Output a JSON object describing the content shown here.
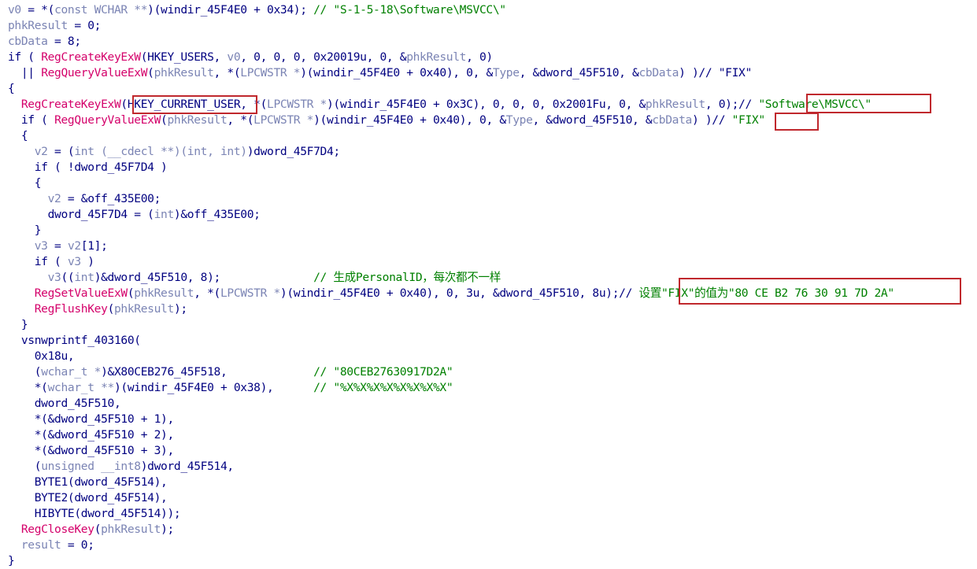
{
  "editor": {
    "lines": [
      [
        [
          "v",
          "v0"
        ],
        [
          "n",
          " = *("
        ],
        [
          "v",
          "const WCHAR **"
        ],
        [
          "n",
          ")(windir_45F4E0 + 0x34); "
        ],
        [
          "c",
          "// \"S-1-5-18\\Software\\MSVCC\\\""
        ]
      ],
      [
        [
          "v",
          "phkResult"
        ],
        [
          "n",
          " = 0;"
        ]
      ],
      [
        [
          "v",
          "cbData"
        ],
        [
          "n",
          " = 8;"
        ]
      ],
      [
        [
          "n",
          "if ( "
        ],
        [
          "f",
          "RegCreateKeyExW"
        ],
        [
          "n",
          "(HKEY_USERS, "
        ],
        [
          "v",
          "v0"
        ],
        [
          "n",
          ", 0, 0, 0, 0x20019u, 0, &"
        ],
        [
          "v",
          "phkResult"
        ],
        [
          "n",
          ", 0)"
        ]
      ],
      [
        [
          "n",
          "  || "
        ],
        [
          "f",
          "RegQueryValueExW"
        ],
        [
          "n",
          "("
        ],
        [
          "v",
          "phkResult"
        ],
        [
          "n",
          ", *("
        ],
        [
          "v",
          "LPCWSTR *"
        ],
        [
          "n",
          ")(windir_45F4E0 + 0x40), 0, &"
        ],
        [
          "v",
          "Type"
        ],
        [
          "n",
          ", &dword_45F510, &"
        ],
        [
          "v",
          "cbData"
        ],
        [
          "n",
          ") )// \"FIX\""
        ]
      ],
      [
        [
          "n",
          "{"
        ]
      ],
      [
        [
          "n",
          "  "
        ],
        [
          "f",
          "RegCreateKeyExW"
        ],
        [
          "n",
          "(HKEY_CURRENT_USER, *("
        ],
        [
          "v",
          "LPCWSTR *"
        ],
        [
          "n",
          ")(windir_45F4E0 + 0x3C), 0, 0, 0, 0x2001Fu, 0, &"
        ],
        [
          "v",
          "phkResult"
        ],
        [
          "n",
          ", 0);// "
        ],
        [
          "c",
          "\"Software\\MSVCC\\\""
        ]
      ],
      [
        [
          "n",
          "  if ( "
        ],
        [
          "f",
          "RegQueryValueExW"
        ],
        [
          "n",
          "("
        ],
        [
          "v",
          "phkResult"
        ],
        [
          "n",
          ", *("
        ],
        [
          "v",
          "LPCWSTR *"
        ],
        [
          "n",
          ")(windir_45F4E0 + 0x40), 0, &"
        ],
        [
          "v",
          "Type"
        ],
        [
          "n",
          ", &dword_45F510, &"
        ],
        [
          "v",
          "cbData"
        ],
        [
          "n",
          ") )// "
        ],
        [
          "c",
          "\"FIX\""
        ]
      ],
      [
        [
          "n",
          "  {"
        ]
      ],
      [
        [
          "n",
          "    "
        ],
        [
          "v",
          "v2"
        ],
        [
          "n",
          " = ("
        ],
        [
          "v",
          "int (__cdecl **)(int, int)"
        ],
        [
          "n",
          ")dword_45F7D4;"
        ]
      ],
      [
        [
          "n",
          "    if ( !dword_45F7D4 )"
        ]
      ],
      [
        [
          "n",
          "    {"
        ]
      ],
      [
        [
          "n",
          "      "
        ],
        [
          "v",
          "v2"
        ],
        [
          "n",
          " = &off_435E00;"
        ]
      ],
      [
        [
          "n",
          "      dword_45F7D4 = ("
        ],
        [
          "v",
          "int"
        ],
        [
          "n",
          ")&off_435E00;"
        ]
      ],
      [
        [
          "n",
          "    }"
        ]
      ],
      [
        [
          "n",
          "    "
        ],
        [
          "v",
          "v3"
        ],
        [
          "n",
          " = "
        ],
        [
          "v",
          "v2"
        ],
        [
          "n",
          "[1];"
        ]
      ],
      [
        [
          "n",
          "    if ( "
        ],
        [
          "v",
          "v3"
        ],
        [
          "n",
          " )"
        ]
      ],
      [
        [
          "n",
          "      "
        ],
        [
          "v",
          "v3"
        ],
        [
          "n",
          "(("
        ],
        [
          "v",
          "int"
        ],
        [
          "n",
          ")&dword_45F510, 8);              "
        ],
        [
          "c",
          "// 生成PersonalID，每次都不一样"
        ]
      ],
      [
        [
          "n",
          "    "
        ],
        [
          "f",
          "RegSetValueExW"
        ],
        [
          "n",
          "("
        ],
        [
          "v",
          "phkResult"
        ],
        [
          "n",
          ", *("
        ],
        [
          "v",
          "LPCWSTR *"
        ],
        [
          "n",
          ")(windir_45F4E0 + 0x40), 0, 3u, &dword_45F510, 8u);// "
        ],
        [
          "c",
          "设置\"FIX\"的值为\"80 CE B2 76 30 91 7D 2A\""
        ]
      ],
      [
        [
          "n",
          "    "
        ],
        [
          "f",
          "RegFlushKey"
        ],
        [
          "n",
          "("
        ],
        [
          "v",
          "phkResult"
        ],
        [
          "n",
          ");"
        ]
      ],
      [
        [
          "n",
          "  }"
        ]
      ],
      [
        [
          "n",
          "  vsnwprintf_403160("
        ]
      ],
      [
        [
          "n",
          "    0x18u,"
        ]
      ],
      [
        [
          "n",
          "    ("
        ],
        [
          "v",
          "wchar_t *"
        ],
        [
          "n",
          ")&X80CEB276_45F518,             "
        ],
        [
          "c",
          "// \"80CEB27630917D2A\""
        ]
      ],
      [
        [
          "n",
          "    *("
        ],
        [
          "v",
          "wchar_t **"
        ],
        [
          "n",
          ")(windir_45F4E0 + 0x38),      "
        ],
        [
          "c",
          "// \"%X%X%X%X%X%X%X%X\""
        ]
      ],
      [
        [
          "n",
          "    dword_45F510,"
        ]
      ],
      [
        [
          "n",
          "    *(&dword_45F510 + 1),"
        ]
      ],
      [
        [
          "n",
          "    *(&dword_45F510 + 2),"
        ]
      ],
      [
        [
          "n",
          "    *(&dword_45F510 + 3),"
        ]
      ],
      [
        [
          "n",
          "    ("
        ],
        [
          "v",
          "unsigned __int8"
        ],
        [
          "n",
          ")dword_45F514,"
        ]
      ],
      [
        [
          "n",
          "    BYTE1(dword_45F514),"
        ]
      ],
      [
        [
          "n",
          "    BYTE2(dword_45F514),"
        ]
      ],
      [
        [
          "n",
          "    HIBYTE(dword_45F514));"
        ]
      ],
      [
        [
          "n",
          "  "
        ],
        [
          "f",
          "RegCloseKey"
        ],
        [
          "n",
          "("
        ],
        [
          "v",
          "phkResult"
        ],
        [
          "n",
          ");"
        ]
      ],
      [
        [
          "n",
          "  "
        ],
        [
          "v",
          "result"
        ],
        [
          "n",
          " = 0;"
        ]
      ],
      [
        [
          "n",
          "}"
        ]
      ]
    ]
  },
  "colors": {
    "normal_text": "#000080",
    "variable_text": "#7b84b4",
    "function_name": "#d4006a",
    "comment_text": "#008000",
    "highlight_box": "#c0282d",
    "background": "#ffffff"
  }
}
